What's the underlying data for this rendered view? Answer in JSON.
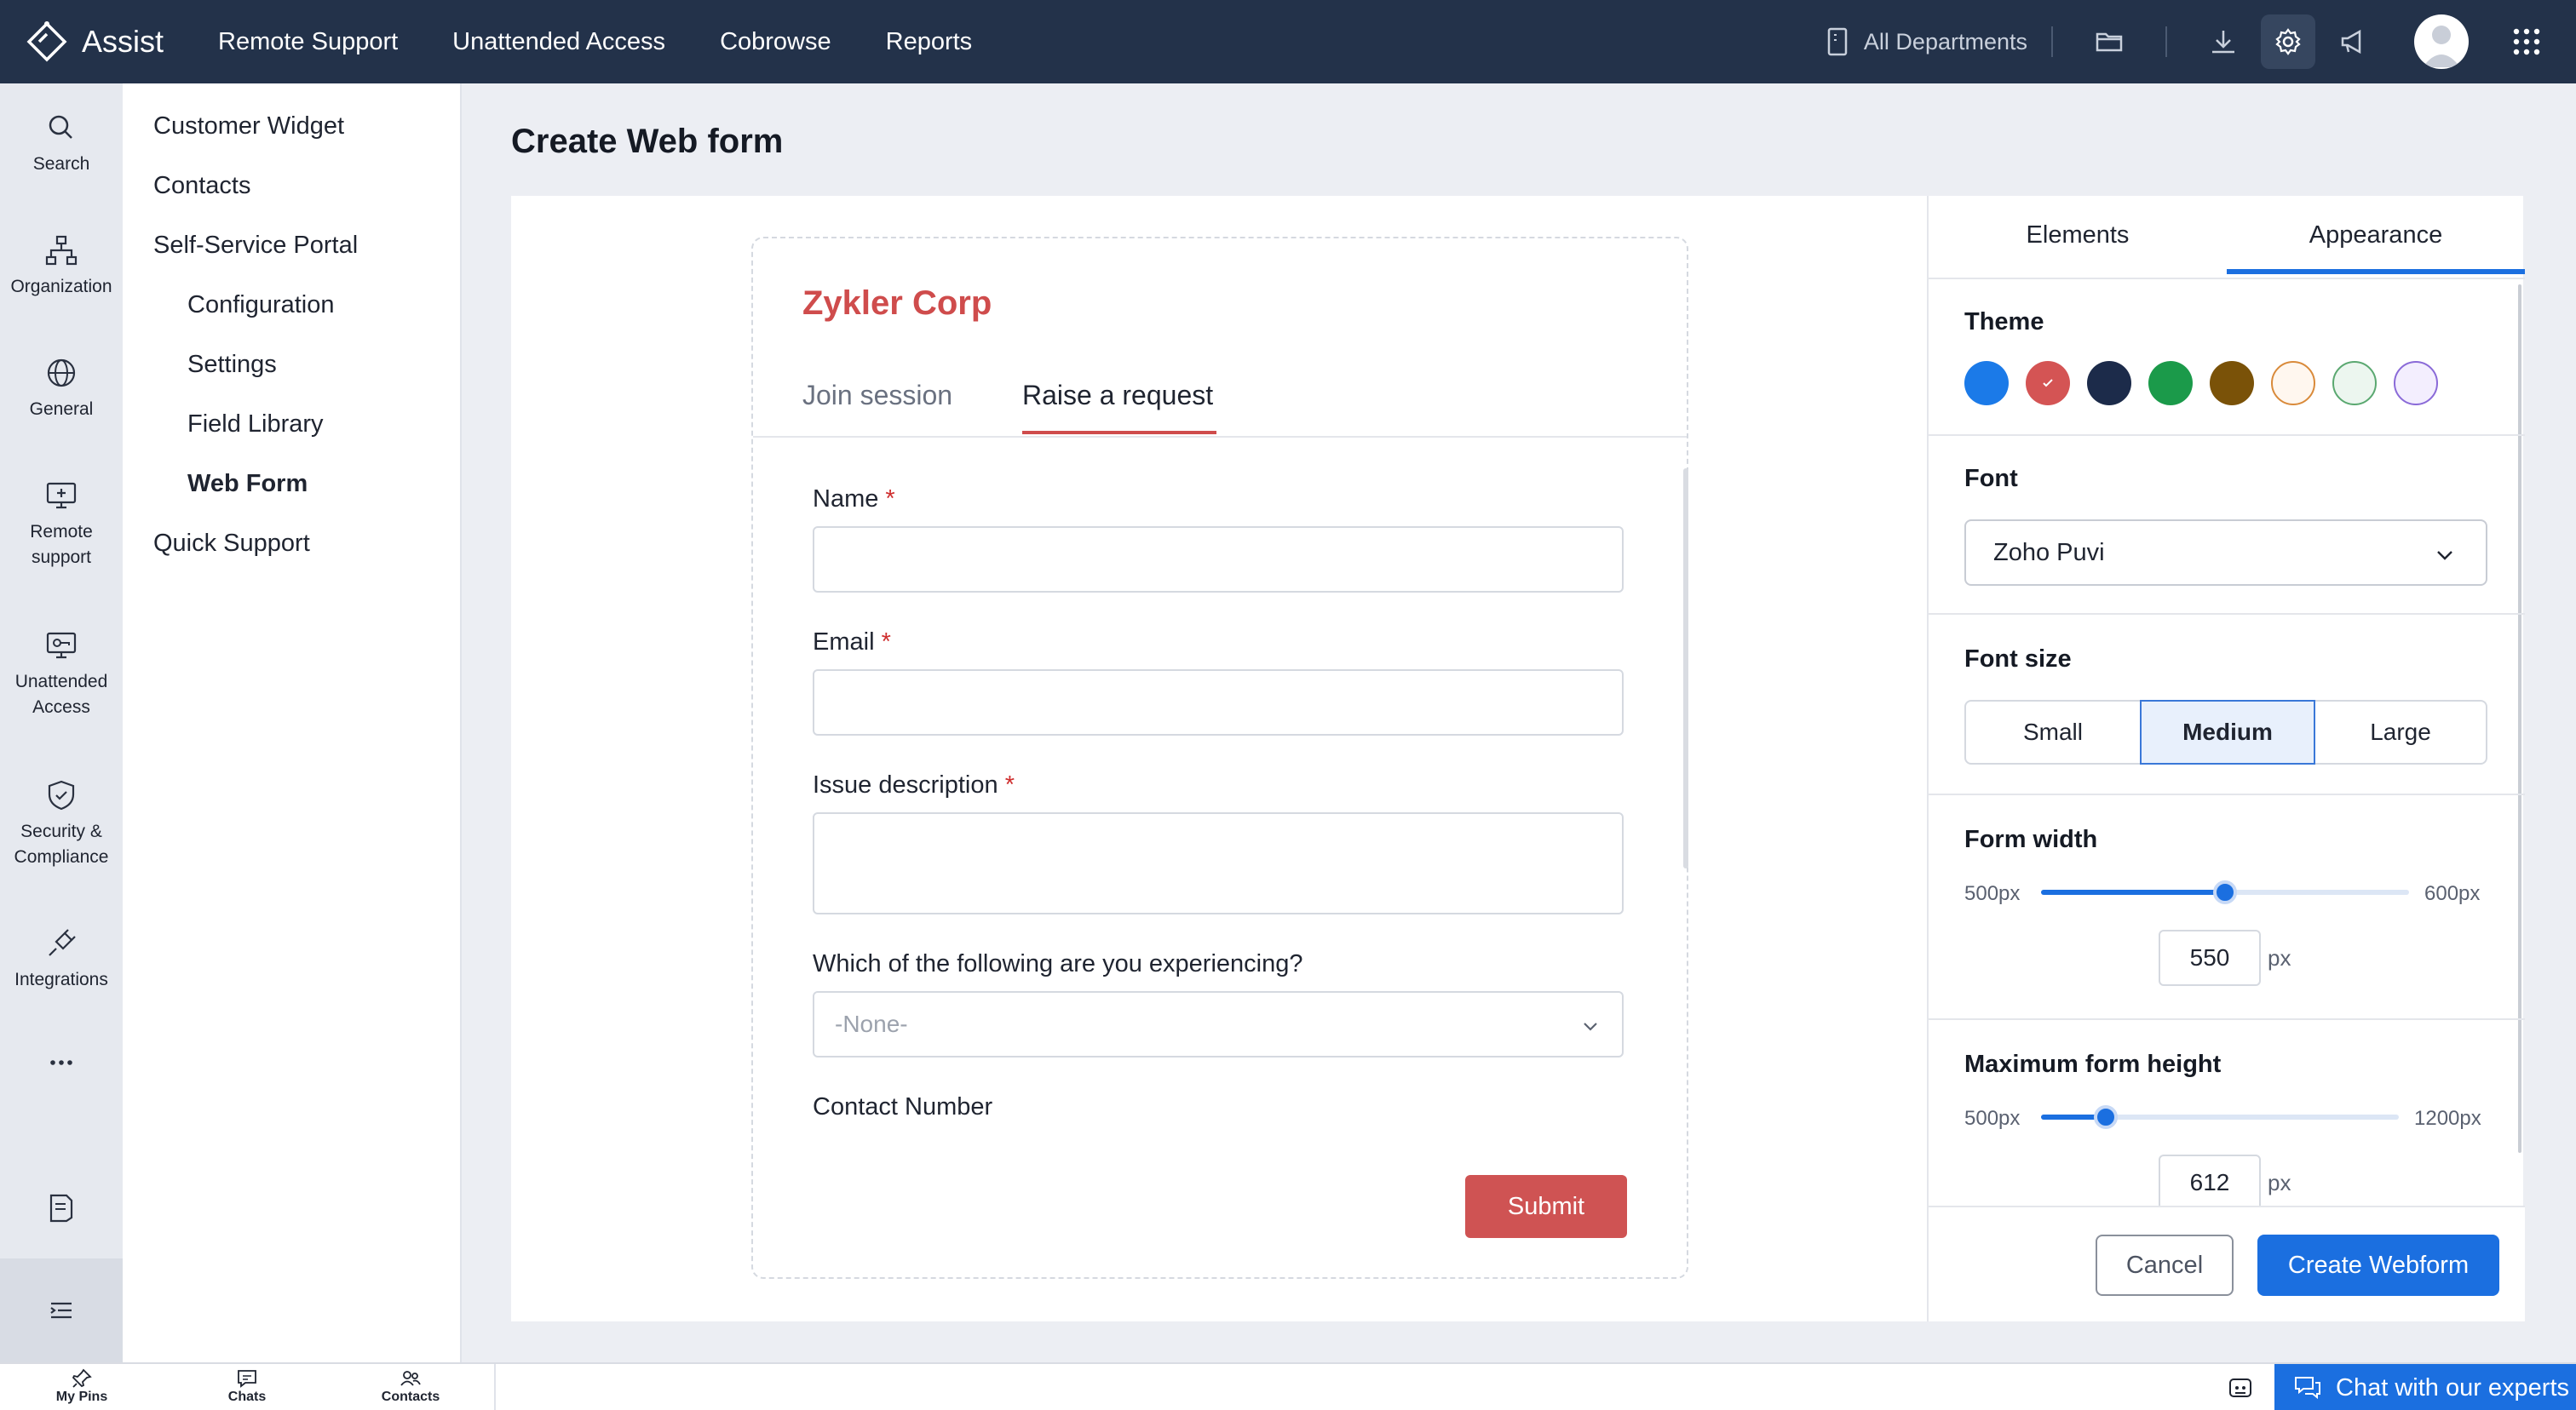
{
  "app": {
    "name": "Assist"
  },
  "topnav": [
    "Remote Support",
    "Unattended Access",
    "Cobrowse",
    "Reports"
  ],
  "header": {
    "department": "All Departments"
  },
  "rail": [
    {
      "label": "Search",
      "icon": "search-icon"
    },
    {
      "label": "Organization",
      "icon": "organization-icon"
    },
    {
      "label": "General",
      "icon": "globe-icon"
    },
    {
      "label": "Remote support",
      "icon": "remote-support-icon"
    },
    {
      "label": "Unattended Access",
      "icon": "unattended-access-icon"
    },
    {
      "label": "Security & Compliance",
      "icon": "shield-icon"
    },
    {
      "label": "Integrations",
      "icon": "plug-icon"
    }
  ],
  "subnav": [
    "Customer Widget",
    "Contacts",
    "Self-Service Portal",
    "Configuration",
    "Settings",
    "Field Library",
    "Web Form",
    "Quick Support"
  ],
  "page": {
    "title": "Create Web form"
  },
  "form": {
    "company": "Zykler Corp",
    "tabs": [
      "Join session",
      "Raise a request"
    ],
    "name_label": "Name",
    "email_label": "Email",
    "issue_label": "Issue description",
    "required_mark": "*",
    "experience_label": "Which of the following are you experiencing?",
    "experience_value": "-None-",
    "contact_label": "Contact Number",
    "submit": "Submit"
  },
  "panel": {
    "tabs": [
      "Elements",
      "Appearance"
    ],
    "active_tab": "Appearance",
    "theme_title": "Theme",
    "theme_colors": [
      "#1b7ae8",
      "#d45454",
      "#1c2b4a",
      "#1b9a4a",
      "#7a5208",
      "#fff7ef",
      "#ecf6ef",
      "#f3eefe"
    ],
    "theme_selected": "#d45454",
    "font_title": "Font",
    "font_value": "Zoho Puvi",
    "fontsize_title": "Font size",
    "fontsize_options": [
      "Small",
      "Medium",
      "Large"
    ],
    "fontsize_selected": "Medium",
    "width_title": "Form width",
    "width_min": "500px",
    "width_max": "600px",
    "width_value": "550",
    "height_title": "Maximum form height",
    "height_min": "500px",
    "height_max": "1200px",
    "height_value": "612",
    "unit": "px",
    "cancel": "Cancel",
    "create": "Create Webform"
  },
  "bottombar": {
    "items": [
      "My Pins",
      "Chats",
      "Contacts"
    ],
    "chat_experts": "Chat with our experts"
  }
}
